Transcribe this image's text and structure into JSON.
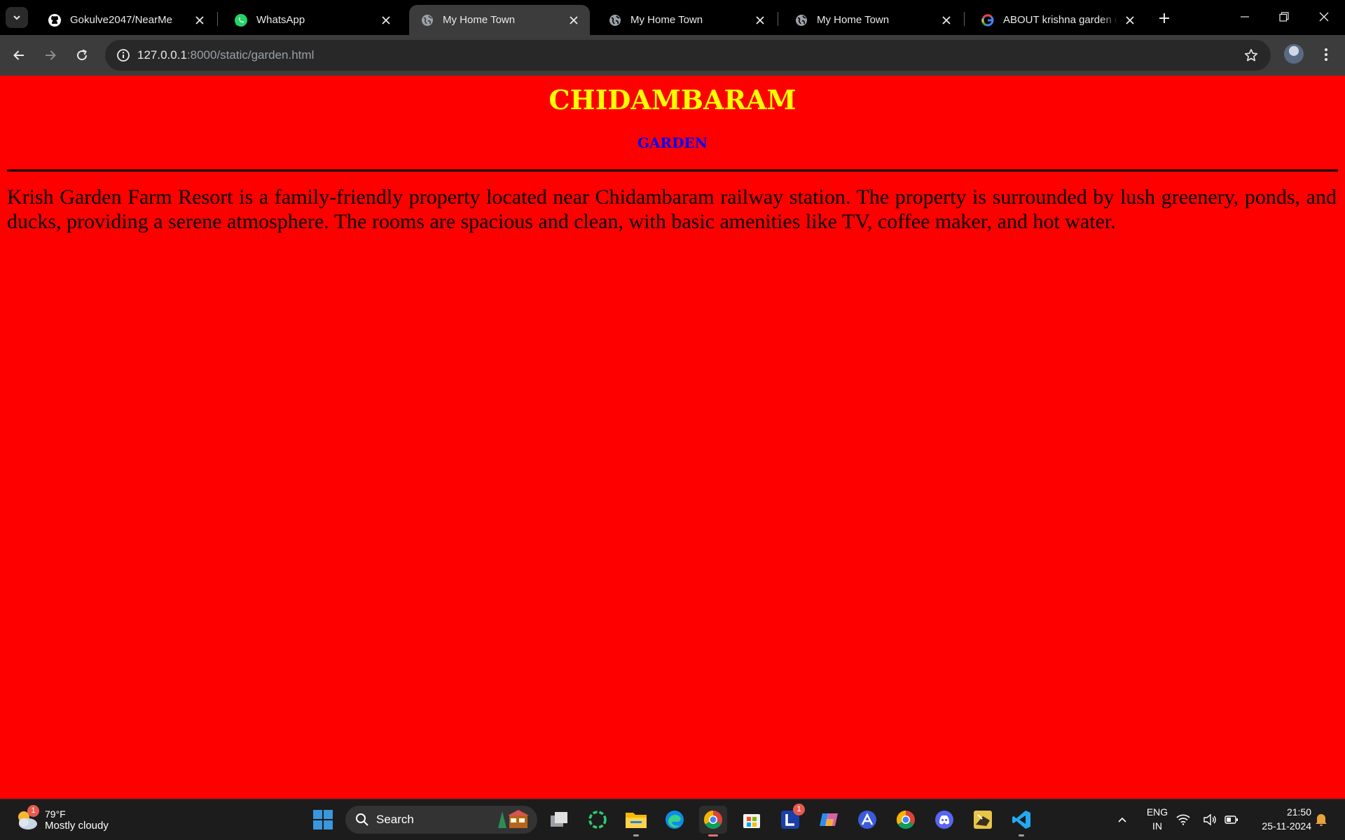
{
  "browser": {
    "tabs": [
      {
        "title": "Gokulve2047/NearMe",
        "favicon": "github-icon",
        "active": false
      },
      {
        "title": "WhatsApp",
        "favicon": "whatsapp-icon",
        "active": false
      },
      {
        "title": "My Home Town",
        "favicon": "globe-icon",
        "active": true
      },
      {
        "title": "My Home Town",
        "favicon": "globe-icon",
        "active": false
      },
      {
        "title": "My Home Town",
        "favicon": "globe-icon",
        "active": false
      },
      {
        "title": "ABOUT krishna garden chi",
        "favicon": "google-icon",
        "active": false
      }
    ],
    "address": {
      "host": "127.0.0.1",
      "rest": ":8000/static/garden.html"
    }
  },
  "page": {
    "background": "#ff0000",
    "heading": "CHIDAMBARAM",
    "heading_color": "#ffff00",
    "subheading": "GARDEN",
    "subheading_color": "#0000ff",
    "paragraph": "Krish Garden Farm Resort is a family-friendly property located near Chidambaram railway station. The property is surrounded by lush greenery, ponds, and ducks, providing a serene atmosphere. The rooms are spacious and clean, with basic amenities like TV, coffee maker, and hot water."
  },
  "taskbar": {
    "weather": {
      "temp": "79°F",
      "condition": "Mostly cloudy",
      "badge": "1"
    },
    "search_label": "Search",
    "pinned": [
      "windows-start-icon",
      "task-view-icon",
      "refresh-app-icon",
      "file-explorer-icon",
      "edge-icon",
      "chrome-icon",
      "microsoft-store-icon",
      "l-app-icon",
      "copilot-icon",
      "a-app-icon",
      "chrome-alt-icon",
      "discord-icon",
      "game-icon",
      "vscode-icon"
    ],
    "l_app_badge": "1",
    "language": {
      "line1": "ENG",
      "line2": "IN"
    },
    "clock": {
      "time": "21:50",
      "date": "25-11-2024"
    }
  }
}
